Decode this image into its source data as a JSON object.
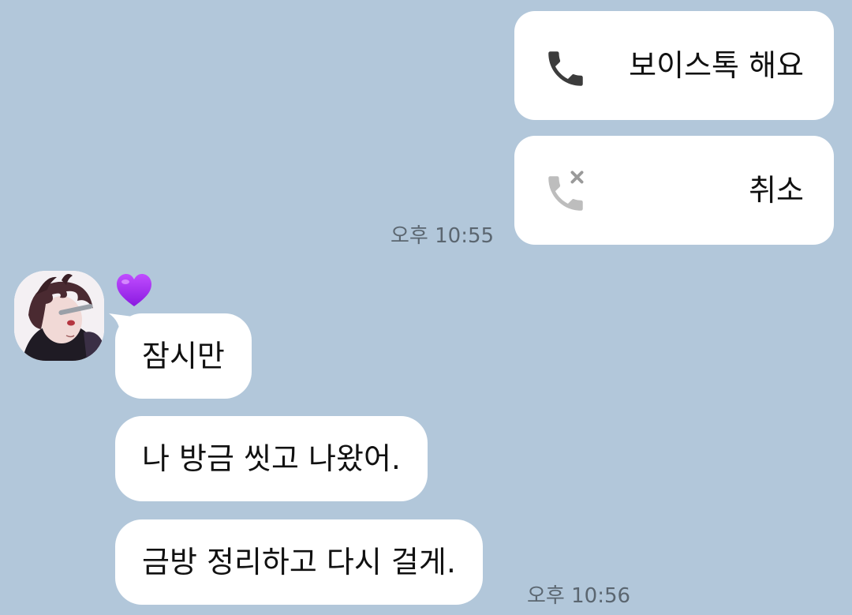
{
  "chat": {
    "outgoing": [
      {
        "icon": "phone-icon",
        "text": "보이스톡 해요"
      },
      {
        "icon": "phone-cancelled-icon",
        "text": "취소"
      }
    ],
    "outgoing_time": "오후 10:55",
    "incoming": {
      "avatar": "profile-avatar",
      "reaction": "purple-heart-icon",
      "messages": [
        "잠시만",
        "나 방금 씻고 나왔어.",
        "금방 정리하고 다시 걸게."
      ],
      "time": "오후 10:56"
    }
  },
  "colors": {
    "background": "#b2c7da",
    "bubble": "#ffffff",
    "timestamp": "#5b6670",
    "heart": "#a32cff"
  }
}
